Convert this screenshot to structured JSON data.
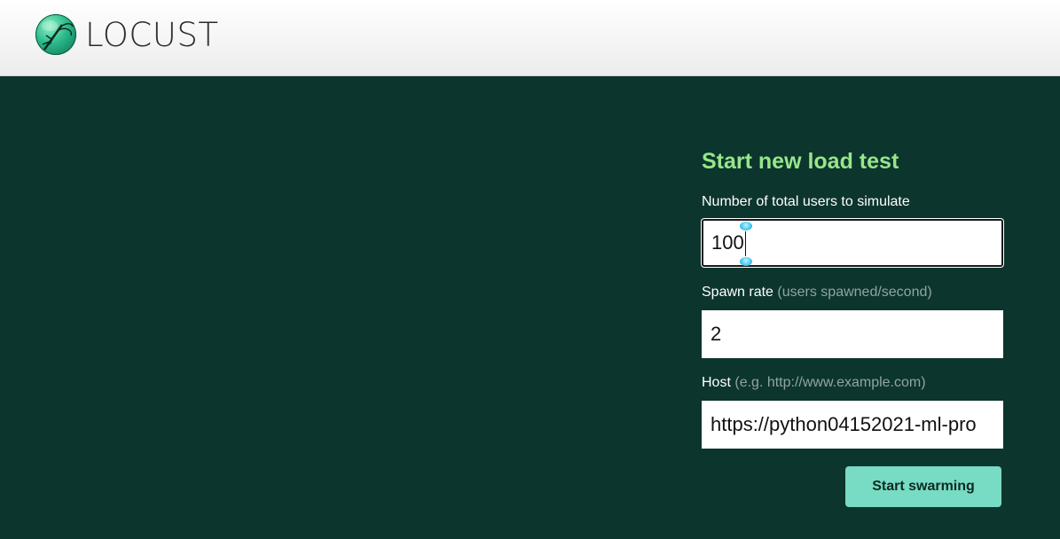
{
  "header": {
    "logo_text": "LOCUST",
    "logo_icon": "locust-logo-icon"
  },
  "form": {
    "title": "Start new load test",
    "users": {
      "label": "Number of total users to simulate",
      "value": "100"
    },
    "spawn_rate": {
      "label": "Spawn rate",
      "hint": "(users spawned/second)",
      "value": "2"
    },
    "host": {
      "label": "Host",
      "hint": "(e.g. http://www.example.com)",
      "value": "https://python04152021-ml-pro"
    },
    "submit_label": "Start swarming"
  },
  "colors": {
    "background": "#0c352d",
    "title": "#97e68a",
    "button": "#78dbc3"
  }
}
